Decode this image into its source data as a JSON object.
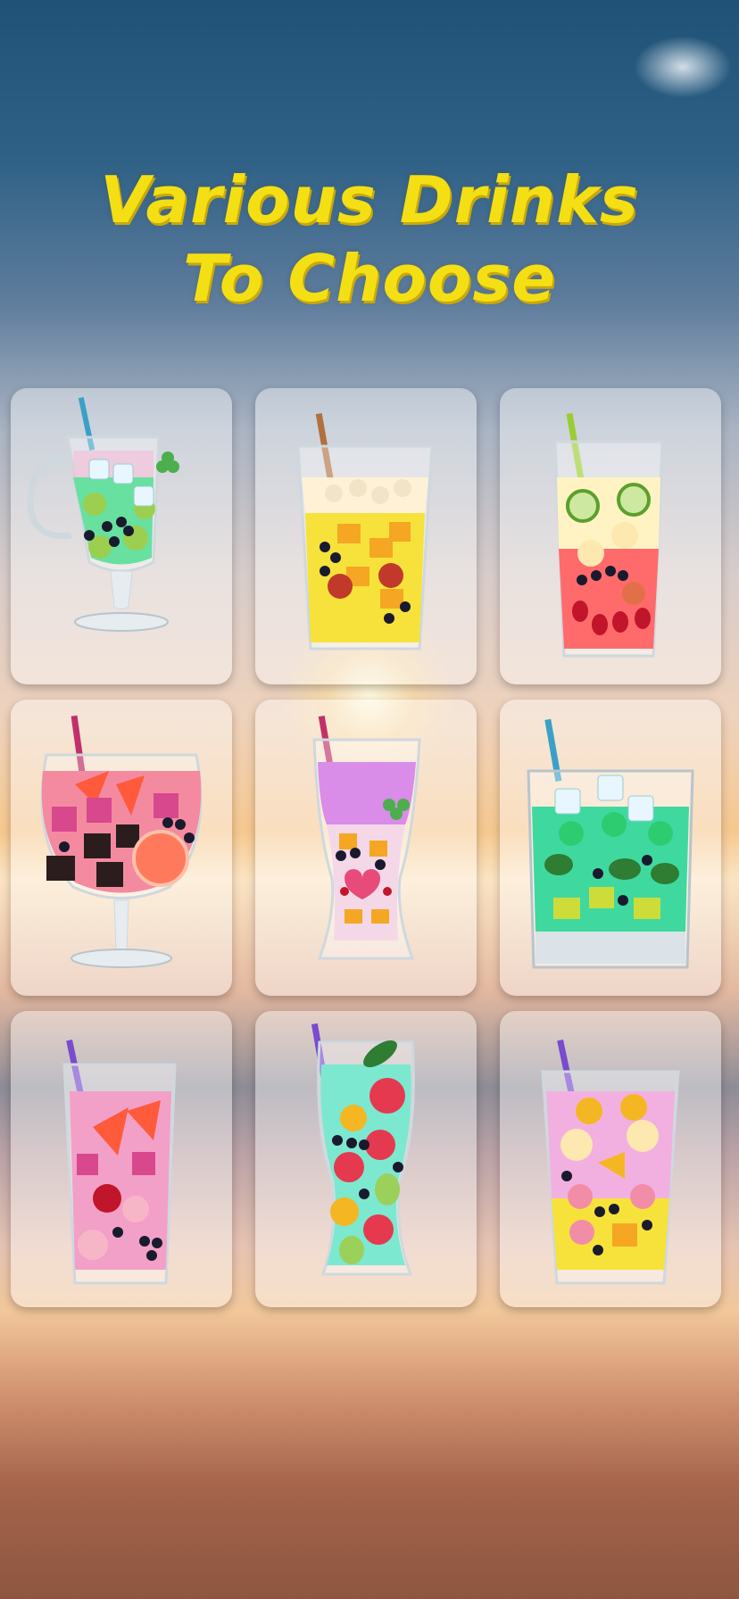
{
  "headline": {
    "line1": "Various Drinks",
    "line2": "To Choose",
    "color": "#f4df14"
  },
  "drinks": [
    {
      "glass": "irish-coffee-mug",
      "liquid": "#67e0a0",
      "straw": "#3aa0c8"
    },
    {
      "glass": "tall-tumbler",
      "liquid": "#f7e23b",
      "straw": "#b07040"
    },
    {
      "glass": "tall-tumbler",
      "liquid": "#ff6b6b",
      "straw": "#9acd32"
    },
    {
      "glass": "brandy-snifter",
      "liquid": "#f48aa0",
      "straw": "#c0306a"
    },
    {
      "glass": "pilsner",
      "liquid": "#d98ce8",
      "straw": "#c0306a"
    },
    {
      "glass": "rocks-glass",
      "liquid": "#3fd9a0",
      "straw": "#3aa0c8"
    },
    {
      "glass": "tall-tumbler",
      "liquid": "#f2a0c8",
      "straw": "#7a4bd0"
    },
    {
      "glass": "pilsner",
      "liquid": "#7de8d0",
      "straw": "#7a4bd0"
    },
    {
      "glass": "tall-tumbler",
      "liquid": "#f2b0e0",
      "straw": "#7a4bd0"
    }
  ]
}
